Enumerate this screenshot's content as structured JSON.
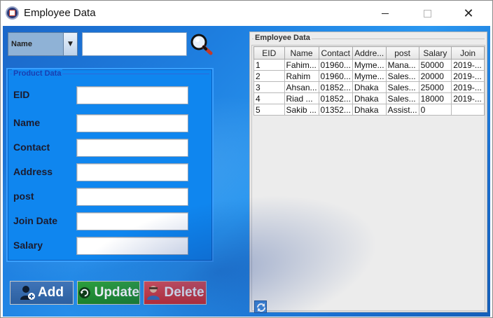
{
  "window": {
    "title": "Employee Data",
    "close_glyph": "✕"
  },
  "search": {
    "field_selected": "Name",
    "dropdown_arrow": "▼",
    "query_value": ""
  },
  "product_panel": {
    "legend": "Product Data",
    "fields": [
      {
        "label": "EID",
        "value": ""
      },
      {
        "label": "Name",
        "value": ""
      },
      {
        "label": "Contact",
        "value": ""
      },
      {
        "label": "Address",
        "value": ""
      },
      {
        "label": "post",
        "value": ""
      },
      {
        "label": "Join Date",
        "value": ""
      },
      {
        "label": "Salary",
        "value": ""
      }
    ]
  },
  "actions": {
    "add_label": "Add",
    "update_label": "Update",
    "delete_label": "Delete"
  },
  "table": {
    "legend": "Employee Data",
    "columns": [
      "EID",
      "Name",
      "Contact",
      "Addre...",
      "post",
      "Salary",
      "Join"
    ],
    "rows": [
      [
        "1",
        "Fahim...",
        "01960...",
        "Myme...",
        "Mana...",
        "50000",
        "2019-..."
      ],
      [
        "2",
        "Rahim",
        "01960...",
        "Myme...",
        "Sales...",
        "20000",
        "2019-..."
      ],
      [
        "3",
        "Ahsan...",
        "01852...",
        "Dhaka",
        "Sales...",
        "25000",
        "2019-..."
      ],
      [
        "4",
        "Riad ...",
        "01852...",
        "Dhaka",
        "Sales...",
        "18000",
        "2019-..."
      ],
      [
        "5",
        "Sakib ...",
        "01352...",
        "Dhaka",
        "Assist...",
        "0",
        ""
      ]
    ]
  },
  "colors": {
    "background_blue": "#1e7fe0",
    "panel_blue": "#0f86ef",
    "add_button": "#3f74b8",
    "update_button": "#2ea43a",
    "delete_button": "#f05252"
  },
  "icons": {
    "app": "employee-app-icon",
    "search": "magnifier-icon",
    "add": "add-user-icon",
    "update": "refresh-icon",
    "delete": "delete-user-icon",
    "table_refresh": "refresh-icon"
  }
}
